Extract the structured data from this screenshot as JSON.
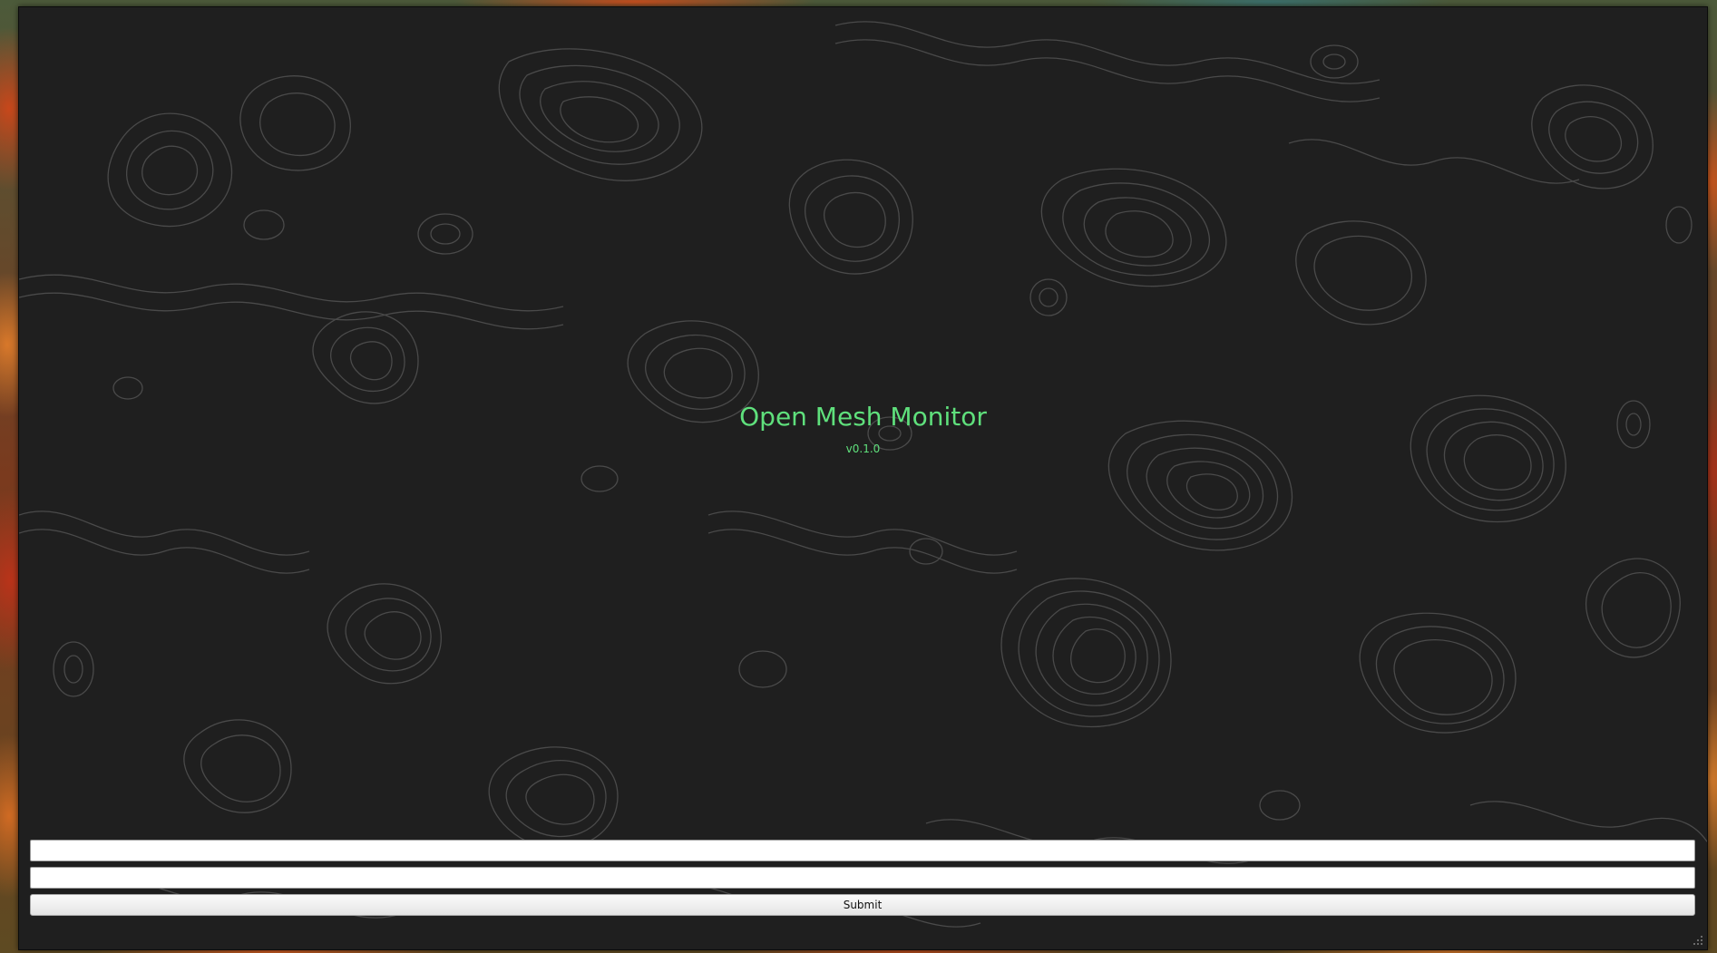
{
  "app": {
    "title": "Open Mesh Monitor",
    "version": "v0.1.0"
  },
  "form": {
    "field1": {
      "value": "",
      "placeholder": ""
    },
    "field2": {
      "value": "",
      "placeholder": ""
    },
    "submit_label": "Submit"
  },
  "colors": {
    "window_bg": "#1f1f1f",
    "contour": "#4a4a4a",
    "accent": "#5fe07c"
  }
}
